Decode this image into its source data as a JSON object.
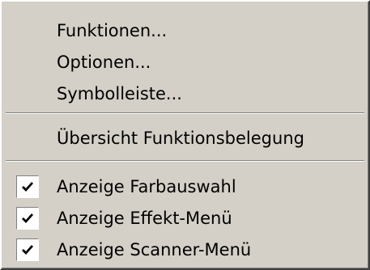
{
  "menu": {
    "items": [
      {
        "label": "Funktionen..."
      },
      {
        "label": "Optionen..."
      },
      {
        "label": "Symbolleiste..."
      },
      {
        "label": "Übersicht Funktionsbelegung"
      },
      {
        "label": "Anzeige Farbauswahl",
        "checked": true
      },
      {
        "label": "Anzeige Effekt-Menü",
        "checked": true
      },
      {
        "label": "Anzeige Scanner-Menü",
        "checked": true
      }
    ]
  }
}
